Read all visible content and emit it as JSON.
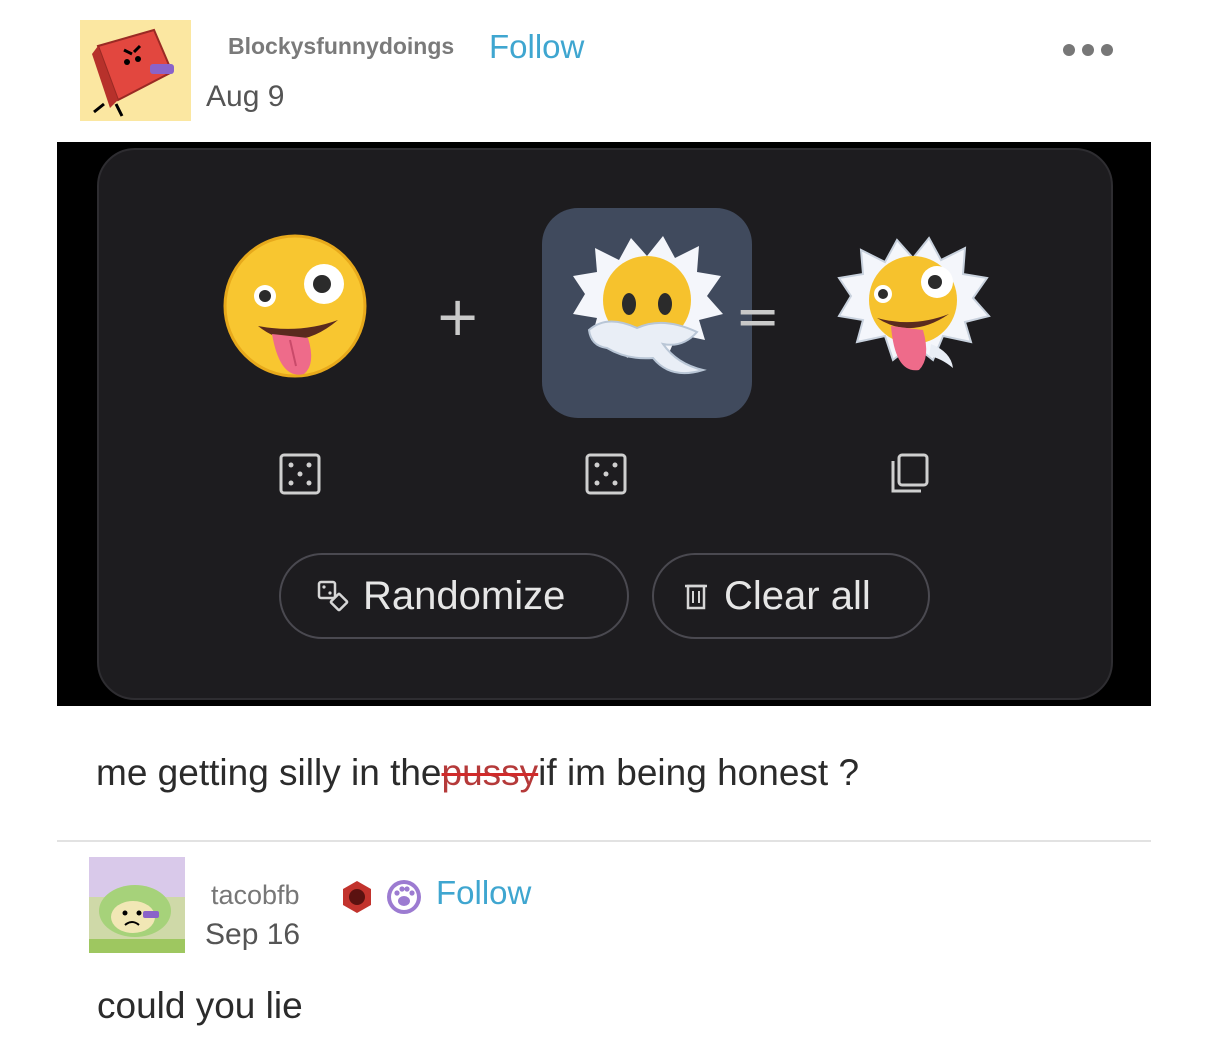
{
  "post": {
    "username": "Blockysfunnydoings",
    "follow_label": "Follow",
    "date": "Aug 9",
    "more_icon": "more-options-icon"
  },
  "kitchen": {
    "plus": "+",
    "equals": "=",
    "left_emoji": "zany-face",
    "right_emoji": "face-in-clouds",
    "result_emoji": "zany-face-in-clouds",
    "randomize_label": "Randomize",
    "clear_label": "Clear all",
    "colors": {
      "selected_tile": "#404a5d",
      "card": "#1d1c1f"
    }
  },
  "caption": {
    "before": "me getting silly in the",
    "struck": "pussy",
    "after": "if im being honest ?"
  },
  "reply": {
    "username": "tacobfb",
    "follow_label": "Follow",
    "date": "Sep 16",
    "text": "could you lie"
  },
  "colors": {
    "follow": "#3fa6d0",
    "strike": "#d12a2a"
  }
}
